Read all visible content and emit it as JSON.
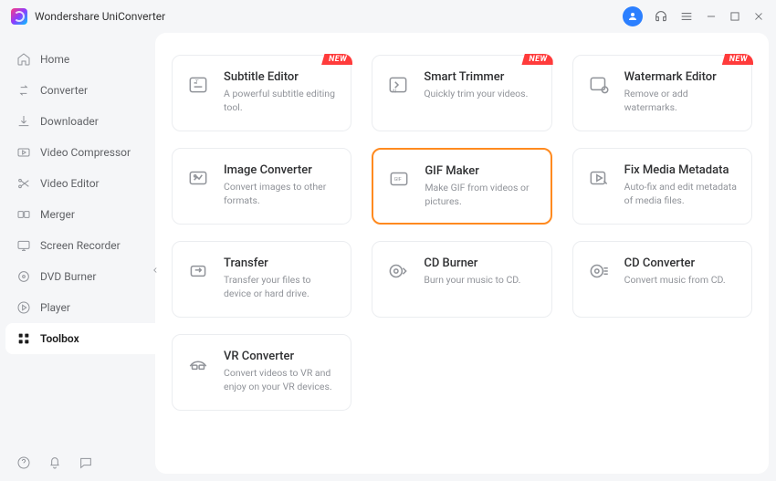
{
  "app_title": "Wondershare UniConverter",
  "badge_text": "NEW",
  "nav": [
    {
      "label": "Home"
    },
    {
      "label": "Converter"
    },
    {
      "label": "Downloader"
    },
    {
      "label": "Video Compressor"
    },
    {
      "label": "Video Editor"
    },
    {
      "label": "Merger"
    },
    {
      "label": "Screen Recorder"
    },
    {
      "label": "DVD Burner"
    },
    {
      "label": "Player"
    },
    {
      "label": "Toolbox"
    }
  ],
  "tools": [
    {
      "title": "Subtitle Editor",
      "desc": "A powerful subtitle editing tool.",
      "new": true
    },
    {
      "title": "Smart Trimmer",
      "desc": "Quickly trim your videos.",
      "new": true
    },
    {
      "title": "Watermark Editor",
      "desc": "Remove or add watermarks.",
      "new": true
    },
    {
      "title": "Image Converter",
      "desc": "Convert images to other formats."
    },
    {
      "title": "GIF Maker",
      "desc": "Make GIF from videos or pictures.",
      "selected": true
    },
    {
      "title": "Fix Media Metadata",
      "desc": "Auto-fix and edit metadata of media files."
    },
    {
      "title": "Transfer",
      "desc": "Transfer your files to device or hard drive."
    },
    {
      "title": "CD Burner",
      "desc": "Burn your music to CD."
    },
    {
      "title": "CD Converter",
      "desc": "Convert music from CD."
    },
    {
      "title": "VR Converter",
      "desc": "Convert videos to VR and enjoy on your VR devices."
    }
  ]
}
